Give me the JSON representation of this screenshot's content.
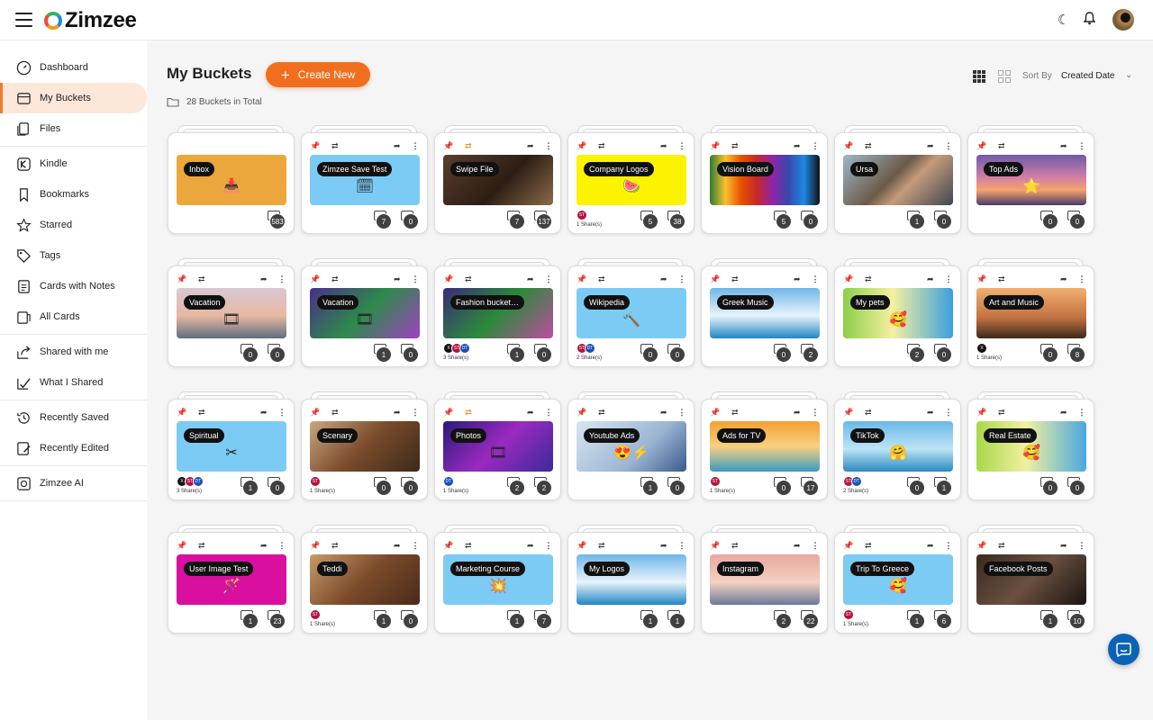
{
  "app": {
    "name": "Zimzee"
  },
  "header": {
    "theme_icon": "moon-icon",
    "notify_icon": "bell-icon"
  },
  "sidebar": {
    "items": [
      {
        "label": "Dashboard",
        "icon": "dashboard-icon"
      },
      {
        "label": "My Buckets",
        "icon": "bucket-icon",
        "active": true
      },
      {
        "label": "Files",
        "icon": "files-icon"
      },
      {
        "label": "Kindle",
        "icon": "kindle-icon"
      },
      {
        "label": "Bookmarks",
        "icon": "bookmark-icon"
      },
      {
        "label": "Starred",
        "icon": "star-icon"
      },
      {
        "label": "Tags",
        "icon": "tag-icon"
      },
      {
        "label": "Cards with Notes",
        "icon": "notes-icon"
      },
      {
        "label": "All Cards",
        "icon": "cards-icon"
      },
      {
        "label": "Shared with me",
        "icon": "share-in-icon"
      },
      {
        "label": "What I Shared",
        "icon": "share-out-icon"
      },
      {
        "label": "Recently Saved",
        "icon": "history-icon"
      },
      {
        "label": "Recently Edited",
        "icon": "edit-icon"
      },
      {
        "label": "Zimzee AI",
        "icon": "ai-icon"
      }
    ]
  },
  "main": {
    "title": "My Buckets",
    "create_label": "Create New",
    "total": "28 Buckets in Total",
    "sort_label": "Sort By",
    "sort_value": "Created Date"
  },
  "colors": {
    "accent": "#f26e1f",
    "active_bg": "#fde7d9",
    "chat": "#0b63b6"
  },
  "buckets": [
    {
      "name": "Inbox",
      "count": "583",
      "inbox": true,
      "bg": "#eba73b",
      "emoji": "📥"
    },
    {
      "name": "Zimzee Save Test",
      "a": "7",
      "b": "0",
      "bg": "#7ccbf5",
      "emoji": "🗓",
      "pin": true,
      "move": false
    },
    {
      "name": "Swipe File",
      "a": "7",
      "b": "137",
      "bg": "linear-gradient(135deg,#5a3d2b,#2c1e14 55%,#8a6a4a)",
      "pin": false,
      "move": true
    },
    {
      "name": "Company Logos",
      "a": "5",
      "b": "38",
      "bg": "#fbf300",
      "emoji": "🍉",
      "pin": true,
      "shares": [
        "ST"
      ],
      "share_text": "1 Share(s)"
    },
    {
      "name": "Vision Board",
      "a": "5",
      "b": "0",
      "bg": "linear-gradient(90deg,#2e7d32,#fbc02d,#e65100,#c62828,#8e24aa,#3949ab,#1e88e5,#111)"
    },
    {
      "name": "Ursa",
      "a": "1",
      "b": "0",
      "bg": "linear-gradient(135deg,#9fb8c9,#6b5a48 45%,#c59b7a 60%,#3d4652)"
    },
    {
      "name": "Top Ads",
      "a": "0",
      "b": "0",
      "bg": "linear-gradient(180deg,#6e5aa8,#d17fa6 45%,#f5a36a 70%,#4a3a6b)",
      "emoji": "⭐"
    },
    {
      "name": "Vacation",
      "a": "0",
      "b": "0",
      "bg": "linear-gradient(180deg,#d8c8d4,#e8b8a0 55%,#5e6e80)",
      "emoji": "🎞"
    },
    {
      "name": "Vacation",
      "a": "1",
      "b": "0",
      "bg": "linear-gradient(135deg,#4a2e8a,#2d8a4a 50%,#a040c0)",
      "emoji": "🎞"
    },
    {
      "name": "Fashion bucket…",
      "a": "1",
      "b": "0",
      "bg": "linear-gradient(135deg,#3a2a7a,#2a8a3a 50%,#c04aa0)",
      "shares": [
        "X",
        "ST",
        "DT"
      ],
      "share_text": "3 Share(s)"
    },
    {
      "name": "Wikipedia",
      "a": "0",
      "b": "0",
      "bg": "#7ccbf5",
      "emoji": "🔨",
      "shares": [
        "ST",
        "DT"
      ],
      "share_text": "2 Share(s)"
    },
    {
      "name": "Greek Music",
      "a": "0",
      "b": "2",
      "bg": "linear-gradient(180deg,#6fb6e8,#e8f4fb 55%,#1f86c4)"
    },
    {
      "name": "My pets",
      "a": "2",
      "b": "0",
      "bg": "linear-gradient(90deg,#8ccf4a,#f5f0a0 45%,#3aa0e0)",
      "emoji": "🥰"
    },
    {
      "name": "Art and Music",
      "a": "0",
      "b": "8",
      "bg": "linear-gradient(180deg,#f1b070,#c07040 60%,#3a2a1a)",
      "shares": [
        "X"
      ],
      "share_text": "1 Share(s)"
    },
    {
      "name": "Spiritual",
      "a": "1",
      "b": "0",
      "bg": "#7ccbf5",
      "emoji": "✂",
      "shares": [
        "X",
        "ST",
        "DT"
      ],
      "share_text": "3 Share(s)"
    },
    {
      "name": "Scenary",
      "a": "0",
      "b": "0",
      "bg": "linear-gradient(135deg,#caa680,#7a4a2a 50%,#3a2a1a)",
      "shares": [
        "ST"
      ],
      "share_text": "1 Share(s)"
    },
    {
      "name": "Photos",
      "a": "2",
      "b": "2",
      "bg": "linear-gradient(135deg,#2a1a7a,#9a2ac0 50%,#3a2a9a)",
      "emoji": "🎞",
      "move": true,
      "shares": [
        "DT"
      ],
      "share_text": "1 Share(s)"
    },
    {
      "name": "Youtube Ads",
      "a": "1",
      "b": "0",
      "bg": "linear-gradient(135deg,#d8e6f2,#9ab4d2 60%,#3a5a8a)",
      "emoji": "😍⚡"
    },
    {
      "name": "Ads for TV",
      "a": "0",
      "b": "17",
      "bg": "linear-gradient(180deg,#f5a030,#f8d080 50%,#3a9ac0)",
      "shares": [
        "ST"
      ],
      "share_text": "1 Share(s)"
    },
    {
      "name": "TikTok",
      "a": "0",
      "b": "1",
      "bg": "linear-gradient(180deg,#6ab8e8,#bde4f5 55%,#2a8ac0)",
      "emoji": "🤗",
      "shares": [
        "ST",
        "DT"
      ],
      "share_text": "2 Share(s)"
    },
    {
      "name": "Real Estate",
      "a": "0",
      "b": "0",
      "bg": "linear-gradient(90deg,#a8d84a,#f0f0a0 45%,#4aa8e0)",
      "emoji": "🥰"
    },
    {
      "name": "User Image Test",
      "a": "1",
      "b": "23",
      "bg": "#d90fa0",
      "emoji": "🪄"
    },
    {
      "name": "Teddi",
      "a": "1",
      "b": "0",
      "bg": "linear-gradient(135deg,#c89a6a,#7a4a2a 50%,#4a2a1a)",
      "shares": [
        "ST"
      ],
      "share_text": "1 Share(s)"
    },
    {
      "name": "Marketing Course",
      "a": "1",
      "b": "7",
      "bg": "#7ccbf5",
      "emoji": "💥"
    },
    {
      "name": "My Logos",
      "a": "1",
      "b": "1",
      "bg": "linear-gradient(180deg,#6fb6e8,#e8f4fb 55%,#1f86c4)"
    },
    {
      "name": "Instagram",
      "a": "2",
      "b": "22",
      "bg": "linear-gradient(180deg,#e8a8a0,#f5d0c0 55%,#6a7a9a)"
    },
    {
      "name": "Trip To Greece",
      "a": "1",
      "b": "6",
      "bg": "#7ccbf5",
      "emoji": "🥰",
      "shares": [
        "ST"
      ],
      "share_text": "1 Share(s)"
    },
    {
      "name": "Facebook Posts",
      "a": "1",
      "b": "10",
      "bg": "linear-gradient(135deg,#3a2a20,#6a5040 50%,#1a1410)"
    }
  ]
}
